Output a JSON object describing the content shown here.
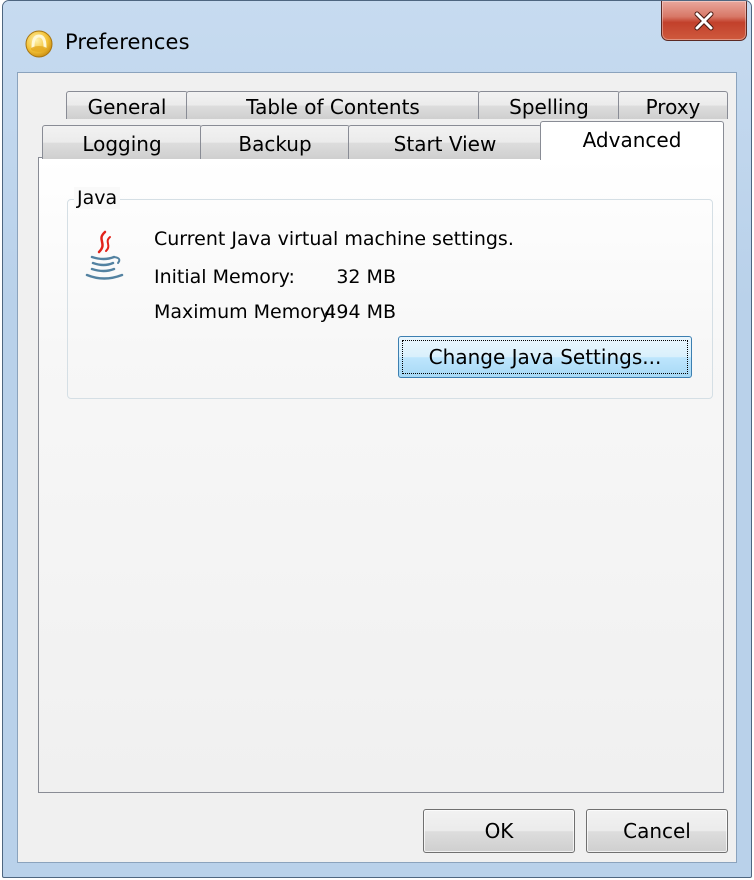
{
  "window": {
    "title": "Preferences",
    "close_label": "X"
  },
  "tabs": {
    "row1": [
      "General",
      "Table of Contents",
      "Spelling",
      "Proxy"
    ],
    "row2": [
      "Logging",
      "Backup",
      "Start View",
      "Advanced"
    ],
    "selected": "Advanced"
  },
  "java_group": {
    "caption": "Java",
    "description": "Current Java virtual machine settings.",
    "initial_memory_label": "Initial Memory:",
    "initial_memory_value": "32 MB",
    "maximum_memory_label": "Maximum Memory:",
    "maximum_memory_value": "494 MB",
    "change_button_label": "Change Java Settings..."
  },
  "buttons": {
    "ok_label": "OK",
    "cancel_label": "Cancel"
  },
  "icons": {
    "app": "app-icon",
    "close": "close-icon",
    "java": "java-icon"
  },
  "colors": {
    "frame": "#b9d1ea",
    "close_button": "#c2402b",
    "focused_button": "#bee6fd"
  }
}
